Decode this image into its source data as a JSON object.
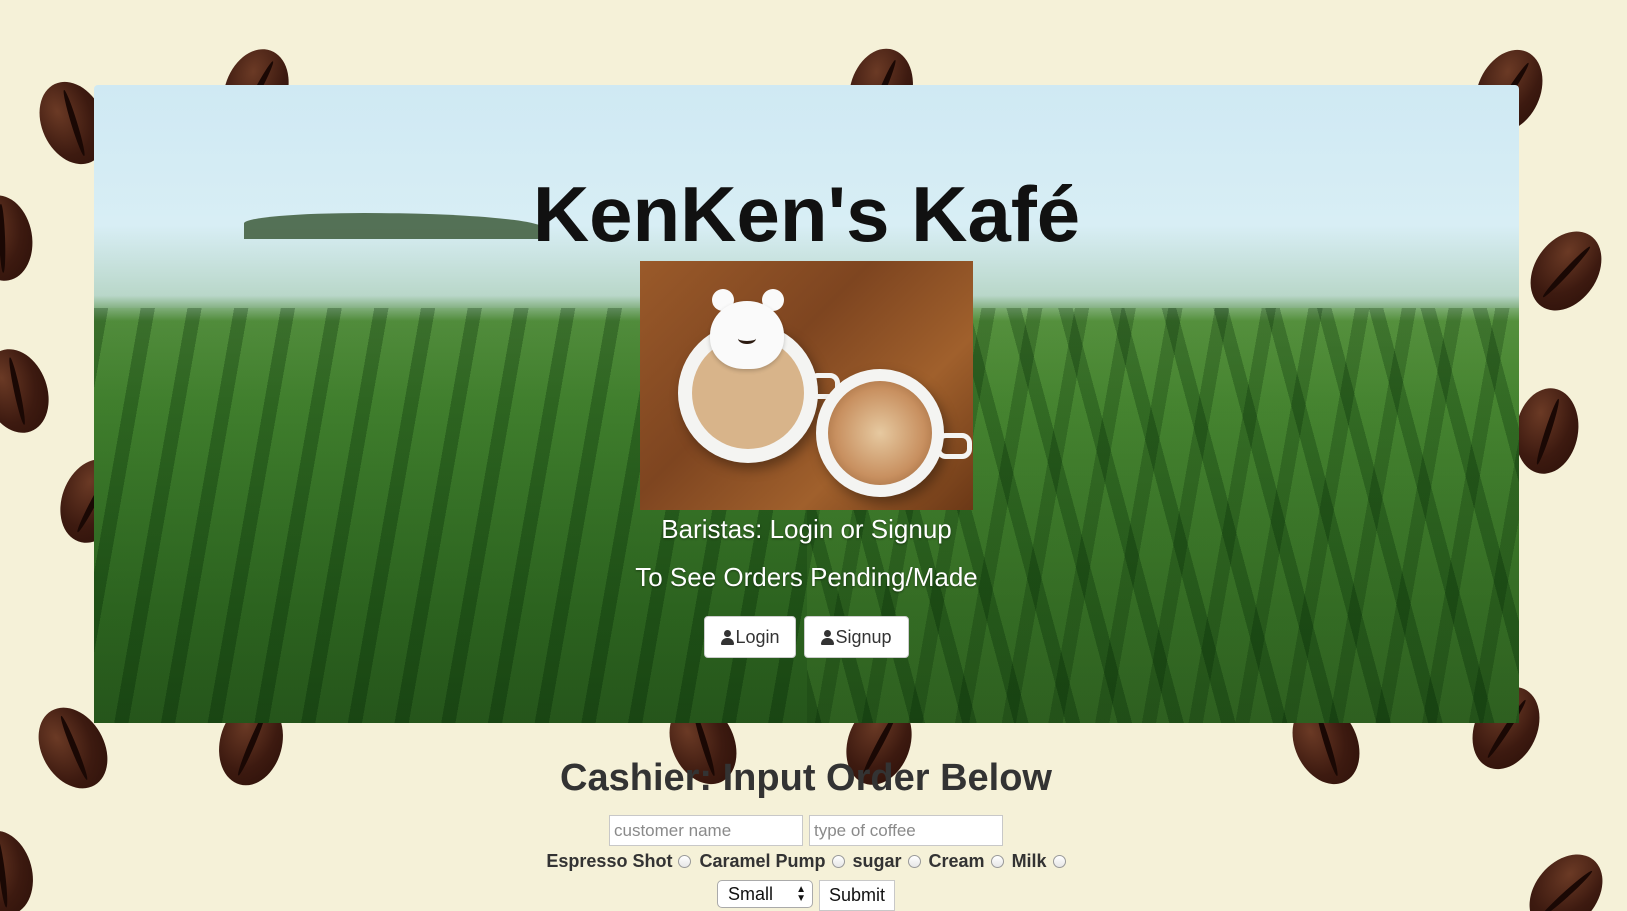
{
  "hero": {
    "title": "KenKen's Kafé",
    "image_alt": "latte art bear and cappuccino",
    "barista_line1": "Baristas: Login or Signup",
    "barista_line2": "To See Orders Pending/Made",
    "login_label": "Login",
    "signup_label": "Signup",
    "icon": "user-icon"
  },
  "cashier": {
    "title": "Cashier: Input Order Below",
    "customer_placeholder": "customer name",
    "coffee_placeholder": "type of coffee",
    "options": [
      {
        "label": "Espresso Shot"
      },
      {
        "label": "Caramel Pump"
      },
      {
        "label": "sugar"
      },
      {
        "label": "Cream"
      },
      {
        "label": "Milk"
      }
    ],
    "size_selected": "Small",
    "submit_label": "Submit"
  },
  "colors": {
    "page_background": "#f5f1d8",
    "bean": "#3d1a10",
    "title_text": "#111111",
    "heading_text": "#333333"
  }
}
